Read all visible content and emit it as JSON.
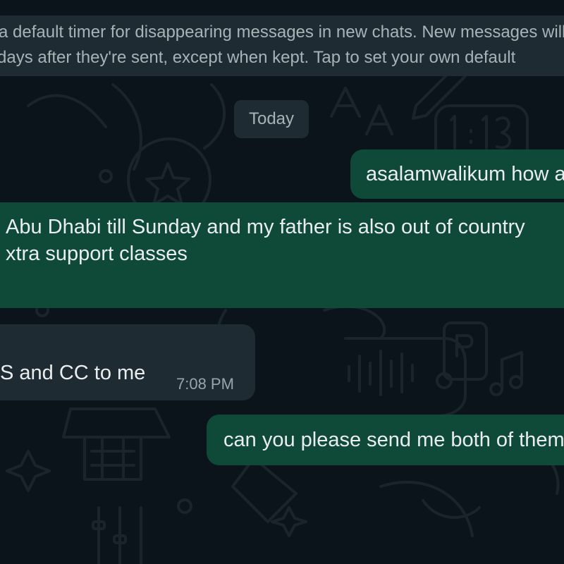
{
  "system_notice": {
    "line1": "a default timer for disappearing messages in new chats. New messages will disappear from this chat",
    "line2": "days after they're sent, except when kept. Tap to set your own default"
  },
  "date_chip": "Today",
  "messages": [
    {
      "direction": "outgoing",
      "text": "asalamwalikum how are you"
    },
    {
      "direction": "outgoing",
      "line1": "Abu Dhabi till Sunday and my father is also out of country",
      "line2": "xtra support classes"
    },
    {
      "direction": "incoming",
      "text": "S and CC to me",
      "time": "7:08 PM"
    },
    {
      "direction": "outgoing",
      "text": "can you please send me both of them"
    }
  ],
  "colors": {
    "chat_background": "#0b141a",
    "outgoing_bubble": "#0f4a38",
    "incoming_bubble": "#1f2b32",
    "system_bubble": "#1f2b32",
    "primary_text": "#e9edef",
    "secondary_text": "#a8b3b8",
    "doodle_stroke": "#1c272d"
  },
  "icons": {
    "wallpaper": "doodle-pattern"
  }
}
